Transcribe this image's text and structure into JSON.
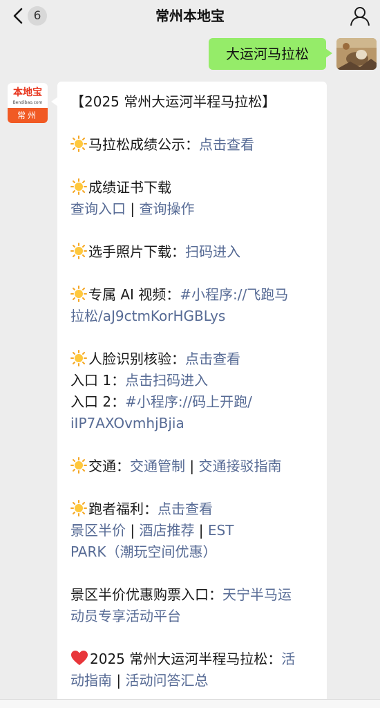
{
  "header": {
    "title": "常州本地宝",
    "unread_count": "6",
    "back_icon": "chevron-left-icon",
    "profile_icon": "person-icon"
  },
  "my_message": {
    "text": "大运河马拉松",
    "bubble_color": "#95ec69"
  },
  "bot": {
    "logo_name": "本地宝",
    "logo_domain": "Bendibao.com",
    "logo_city": "常州"
  },
  "message": {
    "heading": "【2025 常州大运河半程马拉松】",
    "results": {
      "label": "马拉松成绩公示：",
      "link": "点击查看"
    },
    "certificate": {
      "label": "成绩证书下载",
      "link1": "查询入口",
      "sep": " | ",
      "link2": "查询操作"
    },
    "photos": {
      "label": "选手照片下载：",
      "link": "扫码进入"
    },
    "ai_video": {
      "label": "专属 AI 视频：",
      "link_line1": "#小程序://飞跑马",
      "link_line2": "拉松/aJ9ctmKorHGBLys"
    },
    "face_check": {
      "label": "人脸识别核验：",
      "link": "点击查看",
      "entry1_label": "入口 1：",
      "entry1_link": "点击扫码进入",
      "entry2_label": "入口 2：",
      "entry2_link_line1": "#小程序://码上开跑/",
      "entry2_link_line2": "iIP7AXOvmhjBjia"
    },
    "traffic": {
      "label": "交通：",
      "link1": "交通管制",
      "sep": " | ",
      "link2": "交通接驳指南"
    },
    "benefits": {
      "label": "跑者福利：",
      "link": "点击查看",
      "link_a": "景区半价",
      "sep1": " | ",
      "link_b": "酒店推荐",
      "sep2": " | ",
      "link_c_line1": "EST",
      "link_c_line2": "PARK（潮玩空间优惠）"
    },
    "tickets": {
      "label": "景区半价优惠购票入口：",
      "link_line1": "天宁半马运",
      "link_line2": "动员专享活动平台"
    },
    "guide": {
      "label": "2025 常州大运河半程马拉松：",
      "link_line1": "活",
      "link_line2": "动指南",
      "sep": " | ",
      "link2": "活动问答汇总"
    }
  },
  "colors": {
    "link": "#576b95",
    "background": "#ededed",
    "accent_orange": "#f15a24"
  }
}
